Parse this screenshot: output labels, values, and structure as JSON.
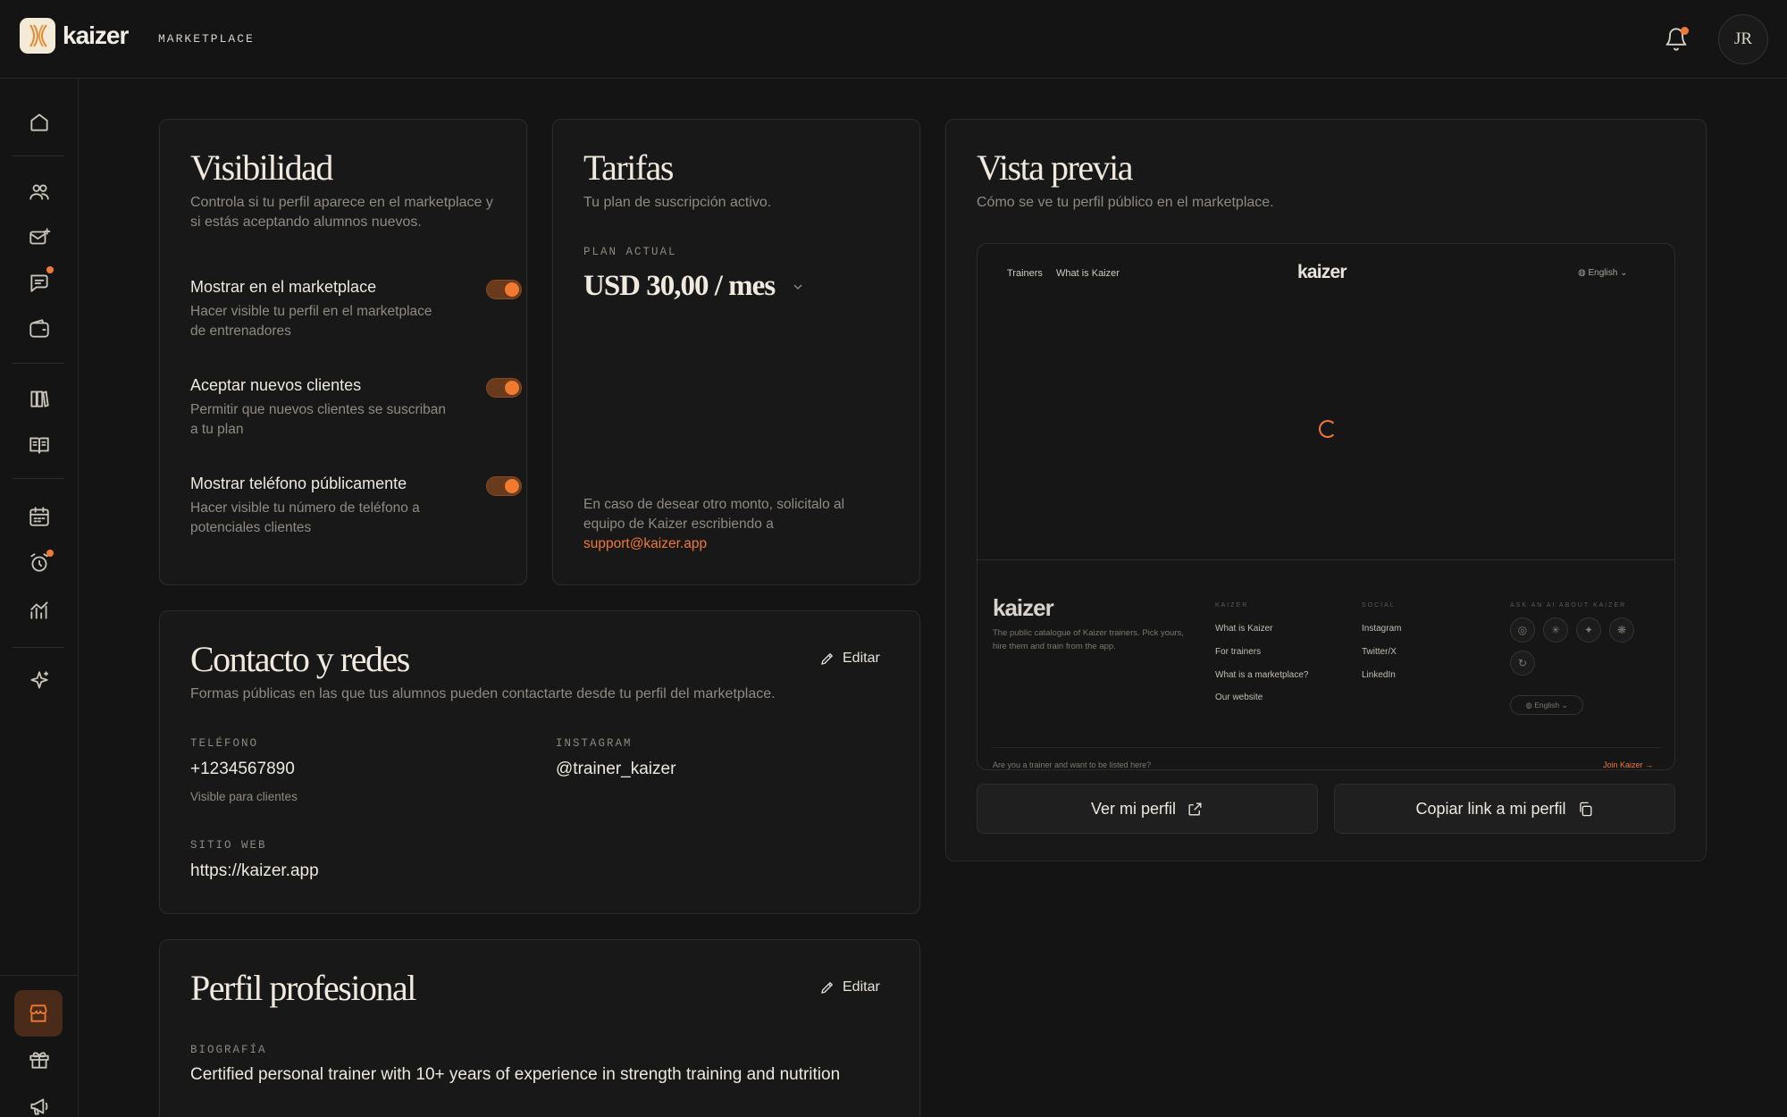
{
  "app": {
    "brand": "kaizer",
    "section": "MARKETPLACE",
    "user_initials": "JR",
    "accent_color": "#f07a2f"
  },
  "sidebar": {
    "icons": [
      "home-icon",
      "users-icon",
      "mail-plus-icon",
      "message-icon",
      "wallet-icon",
      "library-icon",
      "book-icon",
      "calendar-icon",
      "alarm-icon",
      "chart-icon",
      "sparkle-icon"
    ],
    "bottom_icons": [
      "store-icon",
      "gift-icon",
      "megaphone-icon",
      "help-icon"
    ],
    "active": "store-icon"
  },
  "visibility": {
    "title": "Visibilidad",
    "subtitle_line1": "Controla si tu perfil aparece en el marketplace y",
    "subtitle_line2": "si estás aceptando alumnos nuevos.",
    "toggles": [
      {
        "title": "Mostrar en el marketplace",
        "desc": "Hacer visible tu perfil en el marketplace de entrenadores",
        "on": true
      },
      {
        "title": "Aceptar nuevos clientes",
        "desc": "Permitir que nuevos clientes se suscriban a tu plan",
        "on": true
      },
      {
        "title": "Mostrar teléfono públicamente",
        "desc": "Hacer visible tu número de teléfono a potenciales clientes",
        "on": true
      }
    ]
  },
  "rates": {
    "title": "Tarifas",
    "subtitle": "Tu plan de suscripción activo.",
    "plan_label": "PLAN ACTUAL",
    "plan_value": "USD 30,00 / mes",
    "note": "En caso de desear otro monto, solicitalo al equipo de Kaizer escribiendo a",
    "email": "support@kaizer.app"
  },
  "preview": {
    "title": "Vista previa",
    "subtitle": "Cómo se ve tu perfil público en el marketplace.",
    "nav_trainers": "Trainers",
    "nav_what": "What is Kaizer",
    "logo": "kaizer",
    "lang": "English",
    "footer_logo": "kaizer",
    "footer_desc": "The public catalogue of Kaizer trainers. Pick yours, hire them and train from the app.",
    "col1_title": "KAIZER",
    "col1_links": [
      "What is Kaizer",
      "For trainers",
      "What is a marketplace?",
      "Our website"
    ],
    "col2_title": "SOCIAL",
    "col2_links": [
      "Instagram",
      "Twitter/X",
      "LinkedIn"
    ],
    "col3_title": "ASK AN AI ABOUT KAIZER",
    "lang2": "English",
    "bottom_text": "Are you a trainer and want to be listed here?",
    "bottom_link": "Join Kaizer →",
    "view_button": "Ver mi perfil",
    "copy_button": "Copiar link a mi perfil"
  },
  "contact": {
    "title": "Contacto y redes",
    "subtitle": "Formas públicas en las que tus alumnos pueden contactarte desde tu perfil del marketplace.",
    "edit": "Editar",
    "phone_label": "TELÉFONO",
    "phone_value": "+1234567890",
    "phone_note": "Visible para clientes",
    "instagram_label": "INSTAGRAM",
    "instagram_value": "@trainer_kaizer",
    "web_label": "SITIO WEB",
    "web_value": "https://kaizer.app"
  },
  "professional": {
    "title": "Perfil profesional",
    "edit": "Editar",
    "bio_label": "BIOGRAFÍA",
    "bio_value": "Certified personal trainer with 10+ years of experience in strength training and nutrition"
  }
}
